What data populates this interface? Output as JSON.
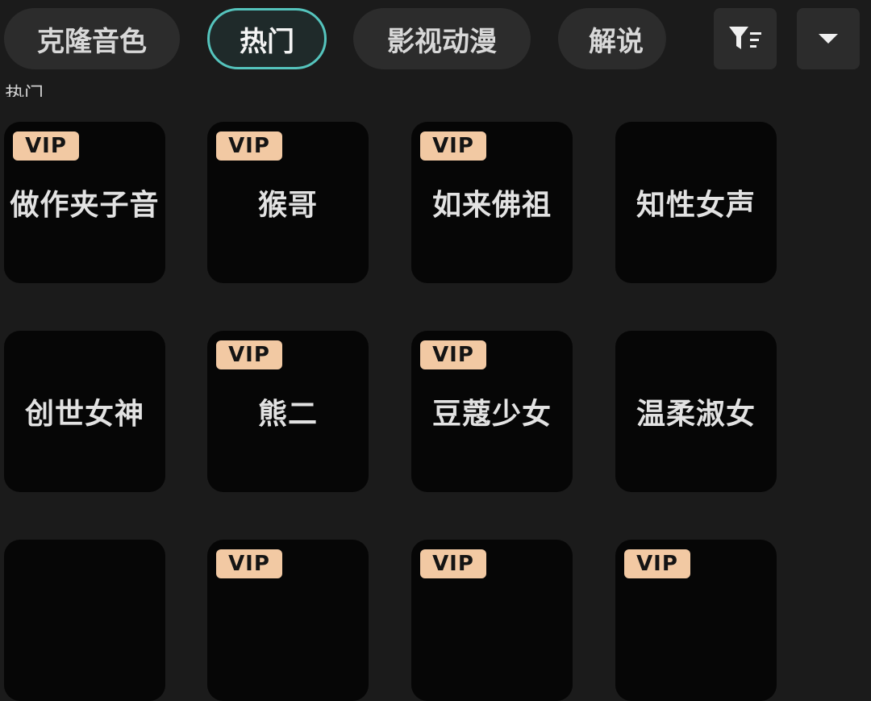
{
  "tabs": [
    {
      "label": "克隆音色",
      "active": false
    },
    {
      "label": "热门",
      "active": true
    },
    {
      "label": "影视动漫",
      "active": false
    },
    {
      "label": "解说",
      "active": false
    }
  ],
  "toolbar": {
    "filter_icon": "filter-sort-icon",
    "dropdown_icon": "caret-down-icon"
  },
  "section": {
    "label": "热门"
  },
  "badge": {
    "vip_label": "VIP",
    "vip_color": "#f2c9a3"
  },
  "colors": {
    "accent": "#55c4bd",
    "background": "#1b1b1b",
    "card": "#060606"
  },
  "voices": [
    {
      "name": "做作夹子音",
      "vip": true
    },
    {
      "name": "猴哥",
      "vip": true
    },
    {
      "name": "如来佛祖",
      "vip": true
    },
    {
      "name": "知性女声",
      "vip": false
    },
    {
      "name": "创世女神",
      "vip": false
    },
    {
      "name": "熊二",
      "vip": true
    },
    {
      "name": "豆蔻少女",
      "vip": true
    },
    {
      "name": "温柔淑女",
      "vip": false
    },
    {
      "name": "",
      "vip": false
    },
    {
      "name": "",
      "vip": true
    },
    {
      "name": "",
      "vip": true
    },
    {
      "name": "",
      "vip": true
    }
  ]
}
